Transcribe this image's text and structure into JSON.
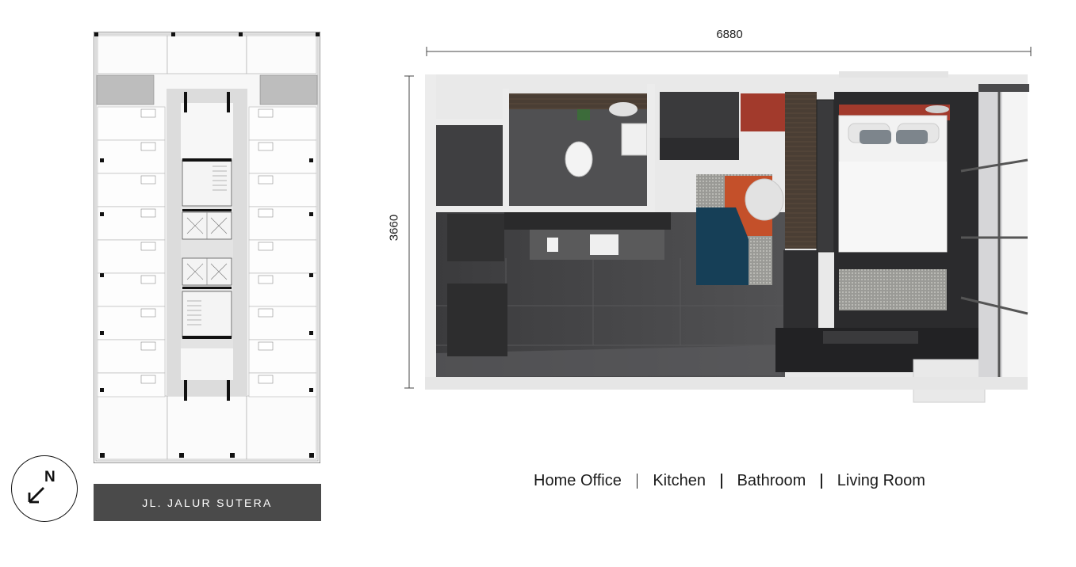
{
  "compass": {
    "letter": "N",
    "icon": "north-arrow-icon"
  },
  "street": {
    "name": "JL. JALUR SUTERA"
  },
  "dimensions": {
    "width": "6880",
    "height": "3660"
  },
  "rooms": [
    "Home Office",
    "Kitchen",
    "Bathroom",
    "Living Room"
  ],
  "colors": {
    "banner": "#4a4a4a",
    "accent_red": "#a23a2c",
    "accent_orange": "#c4502a",
    "accent_teal": "#163f57",
    "floor_dark": "#3d3d3f",
    "wall": "#ececec"
  }
}
